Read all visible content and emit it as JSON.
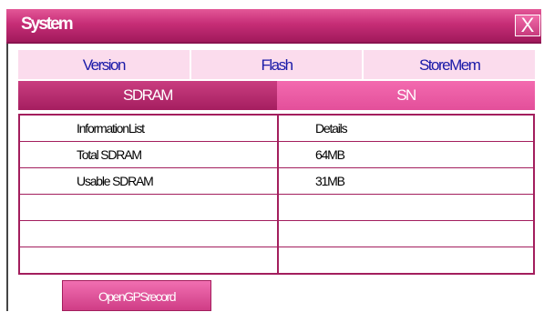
{
  "window": {
    "title": "System",
    "close_glyph": "X"
  },
  "tabs_row1": [
    {
      "label": "Version"
    },
    {
      "label": "Flash"
    },
    {
      "label": "StoreMem"
    }
  ],
  "tabs_row2": [
    {
      "label": "SDRAM",
      "active": true
    },
    {
      "label": "SN",
      "active": false
    }
  ],
  "table": {
    "headers": [
      "InformationList",
      "Details"
    ],
    "rows": [
      [
        "Total SDRAM",
        "64MB"
      ],
      [
        "Usable SDRAM",
        "31MB"
      ],
      [
        "",
        ""
      ],
      [
        "",
        ""
      ],
      [
        "",
        ""
      ]
    ]
  },
  "buttons": {
    "gps_record": "OpenGPSrecord"
  },
  "colors": {
    "accent": "#c62d76",
    "tab_light": "#fbdced",
    "tab_text": "#1a1aa8",
    "border": "#a31e5d"
  },
  "icons": {
    "close": "close-icon"
  }
}
